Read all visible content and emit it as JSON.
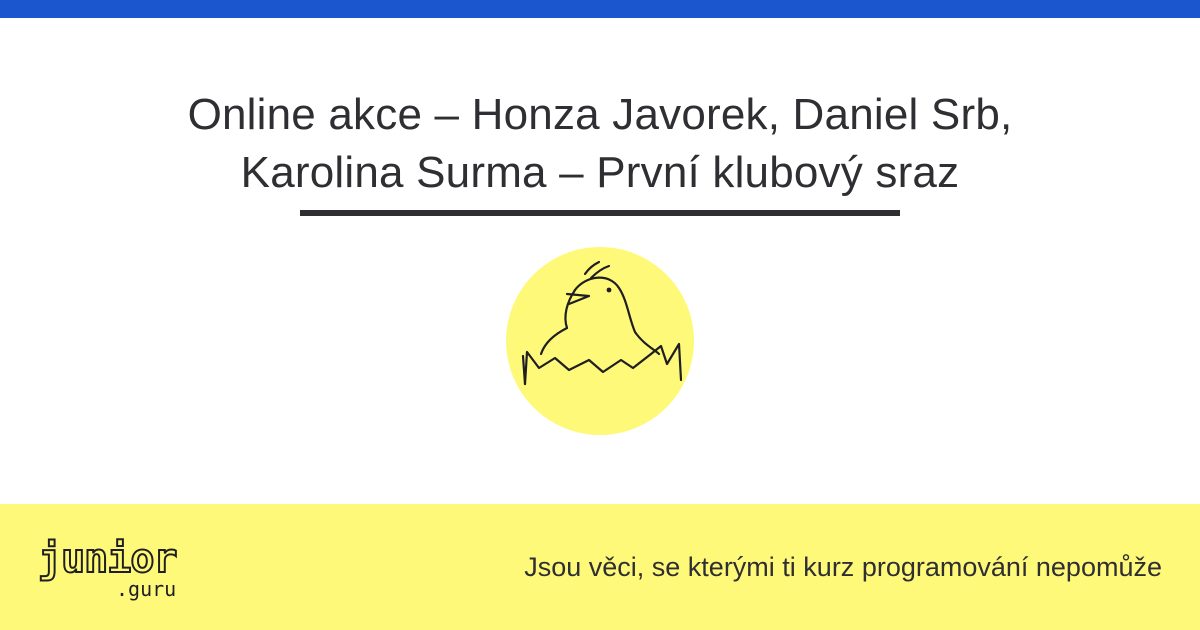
{
  "header": {
    "accent_color": "#1b56cf"
  },
  "main": {
    "title_line_1": "Online akce – Honza Javorek, Daniel Srb,",
    "title_line_2": "Karolina Surma – První klubový sraz",
    "mascot_icon": "hatching-chick-icon",
    "mascot_color": "#fff97a"
  },
  "footer": {
    "background_color": "#fff97a",
    "logo_text_main": "junior",
    "logo_text_sub": ".guru",
    "tagline": "Jsou věci, se kterými ti kurz programování nepomůže"
  }
}
